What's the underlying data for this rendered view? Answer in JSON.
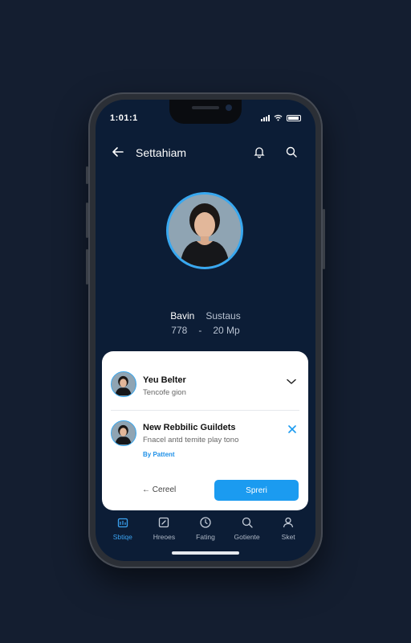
{
  "status_bar": {
    "time": "1:01:1"
  },
  "header": {
    "title": "Settahiam"
  },
  "profile": {
    "stats": [
      {
        "label": "Bavin",
        "detail": "Sustaus"
      },
      {
        "label": "778",
        "detail": "20 Mp"
      }
    ]
  },
  "sheet": {
    "item1": {
      "title": "Yeu Belter",
      "subtitle": "Tencofe gion"
    },
    "item2": {
      "title": "New Rebbilic Guildets",
      "subtitle": "Fnacel antd temite play tono",
      "author": "By Pattent"
    },
    "cancel_label": "Cereel",
    "primary_label": "Spreri"
  },
  "tabs": [
    {
      "label": "Sbtiqe",
      "icon": "home-icon",
      "active": true
    },
    {
      "label": "Hreoes",
      "icon": "edit-icon",
      "active": false
    },
    {
      "label": "Fating",
      "icon": "compass-icon",
      "active": false
    },
    {
      "label": "Gotiente",
      "icon": "search-icon",
      "active": false
    },
    {
      "label": "Sket",
      "icon": "profile-icon",
      "active": false
    }
  ],
  "colors": {
    "accent": "#1b9bf0",
    "background": "#141e30",
    "screen": "#0c1d36"
  }
}
